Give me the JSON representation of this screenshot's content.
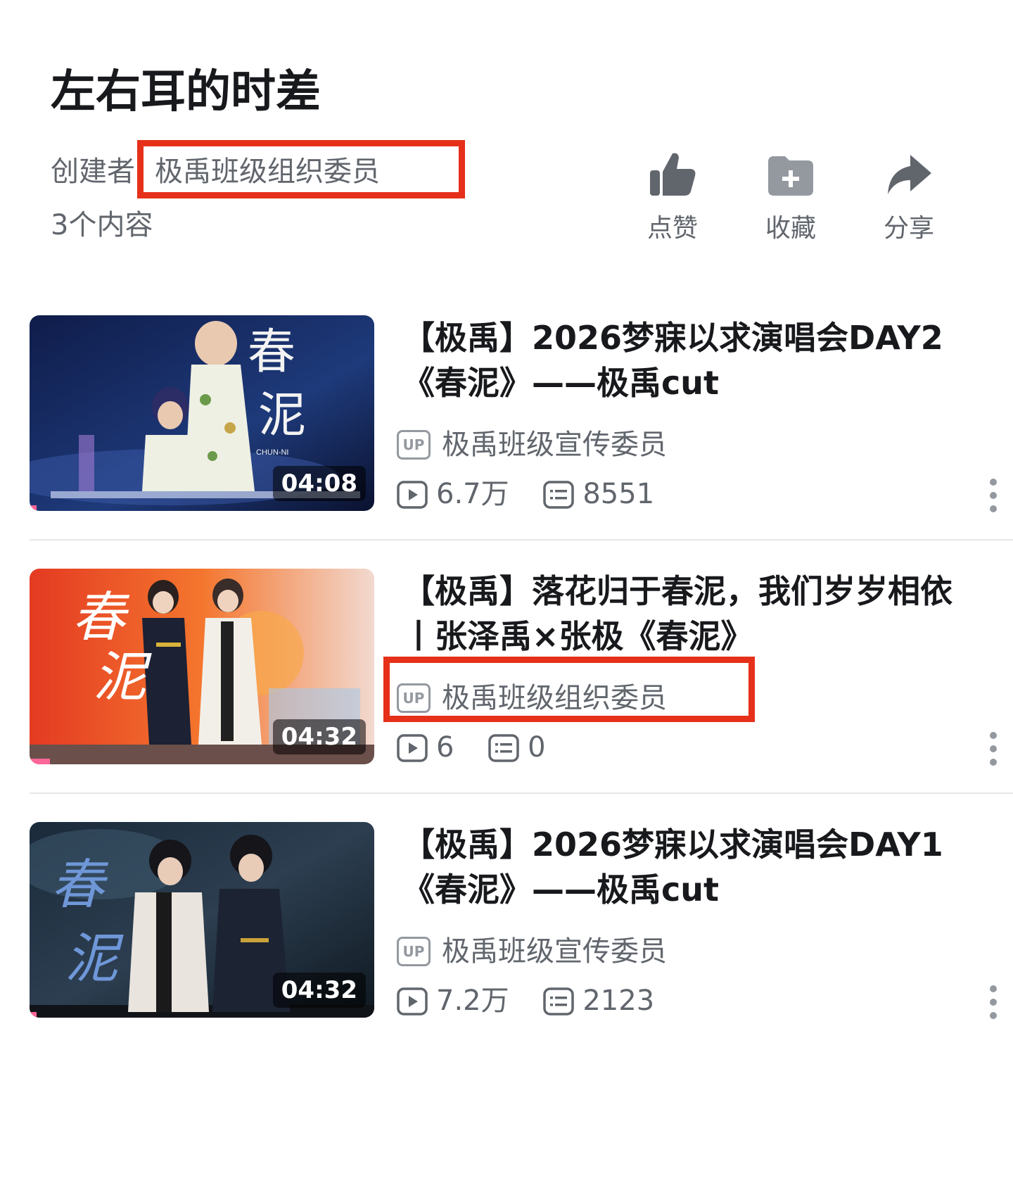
{
  "header": {
    "title": "左右耳的时差",
    "creator_label": "创建者",
    "creator_name": "极禹班级组织委员",
    "content_count": "3个内容"
  },
  "actions": [
    {
      "label": "点赞",
      "icon": "thumbs-up-icon"
    },
    {
      "label": "收藏",
      "icon": "folder-plus-icon"
    },
    {
      "label": "分享",
      "icon": "share-arrow-icon"
    }
  ],
  "videos": [
    {
      "title_line1": "【极禹】2026梦寐以求演唱会DAY2",
      "title_line2": "《春泥》——极禹cut",
      "uploader": "极禹班级宣传委员",
      "up_badge": "UP",
      "views": "6.7万",
      "danmaku": "8551",
      "duration": "04:08",
      "thumb_text": "春泥",
      "thumb_subtext": "CHUN-NI",
      "progress": 0.02
    },
    {
      "title_line1": "【极禹】落花归于春泥，我们岁岁相依",
      "title_line2": "丨张泽禹×张极《春泥》",
      "uploader": "极禹班级组织委员",
      "up_badge": "UP",
      "views": "6",
      "danmaku": "0",
      "duration": "04:32",
      "thumb_text": "春泥",
      "progress": 0.06
    },
    {
      "title_line1": "【极禹】2026梦寐以求演唱会DAY1",
      "title_line2": "《春泥》——极禹cut",
      "uploader": "极禹班级宣传委员",
      "up_badge": "UP",
      "views": "7.2万",
      "danmaku": "2123",
      "duration": "04:32",
      "thumb_text": "春泥",
      "progress": 0.02
    }
  ],
  "colors": {
    "highlight": "#e6301a",
    "secondary_text": "#61666d",
    "icon_gray": "#9499a0",
    "progress": "#ff6699"
  }
}
